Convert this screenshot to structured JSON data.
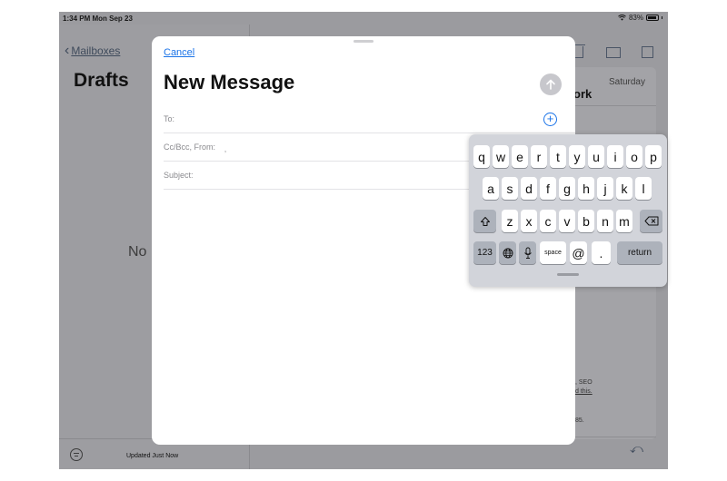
{
  "status_bar": {
    "time_date": "1:34 PM  Mon Sep 23",
    "battery": "83%",
    "wifi_icon": "wifi-icon",
    "battery_icon": "battery-icon"
  },
  "mailbox_list": {
    "back_label": "Mailboxes",
    "title": "Drafts",
    "empty_text": "No",
    "footer_status": "Updated Just Now"
  },
  "message_view": {
    "date": "Saturday",
    "subject_fragment": "ork",
    "body_fragments": [
      ", SEO",
      "d this.",
      "85."
    ]
  },
  "compose": {
    "cancel_label": "Cancel",
    "title": "New Message",
    "to_label": "To:",
    "cc_label": "Cc/Bcc, From:",
    "cc_value": "‚",
    "subject_label": "Subject:",
    "add_contact_symbol": "+"
  },
  "keyboard": {
    "row1": [
      "q",
      "w",
      "e",
      "r",
      "t",
      "y",
      "u",
      "i",
      "o",
      "p"
    ],
    "row2": [
      "a",
      "s",
      "d",
      "f",
      "g",
      "h",
      "j",
      "k",
      "l"
    ],
    "row3": [
      "z",
      "x",
      "c",
      "v",
      "b",
      "n",
      "m"
    ],
    "numbers_label": "123",
    "space_label": "space",
    "at_label": "@",
    "period_label": ".",
    "return_label": "return"
  },
  "colors": {
    "accent": "#1a73e8",
    "dim_background": "#9b9b9f",
    "keyboard_bg": "#d2d4da"
  }
}
